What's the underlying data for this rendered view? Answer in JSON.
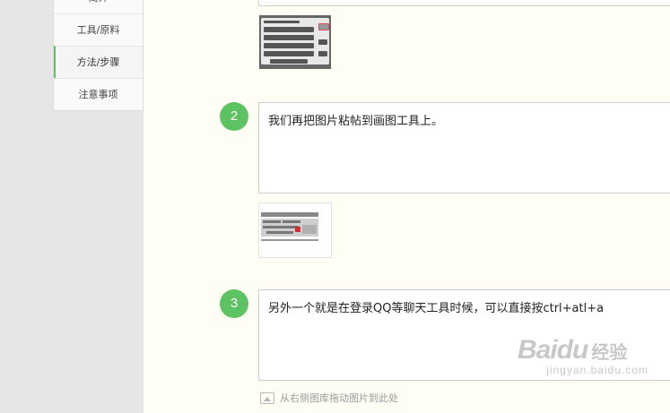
{
  "sidebar": {
    "items": [
      {
        "label": "简介"
      },
      {
        "label": "工具/原料"
      },
      {
        "label": "方法/步骤"
      },
      {
        "label": "注意事项"
      }
    ]
  },
  "steps": [
    {
      "number": "2",
      "text": "我们再把图片粘帖到画图工具上。"
    },
    {
      "number": "3",
      "text": "另外一个就是在登录QQ等聊天工具时候，可以直接按ctrl+atl+a"
    }
  ],
  "upload_hint": "从右侧图库拖动图片到此处",
  "watermark": {
    "brand": "Baidu",
    "cn": "经验",
    "url": "jingyan.baidu.com"
  },
  "colors": {
    "accent": "#5dc261",
    "content_bg": "#fffef5"
  }
}
